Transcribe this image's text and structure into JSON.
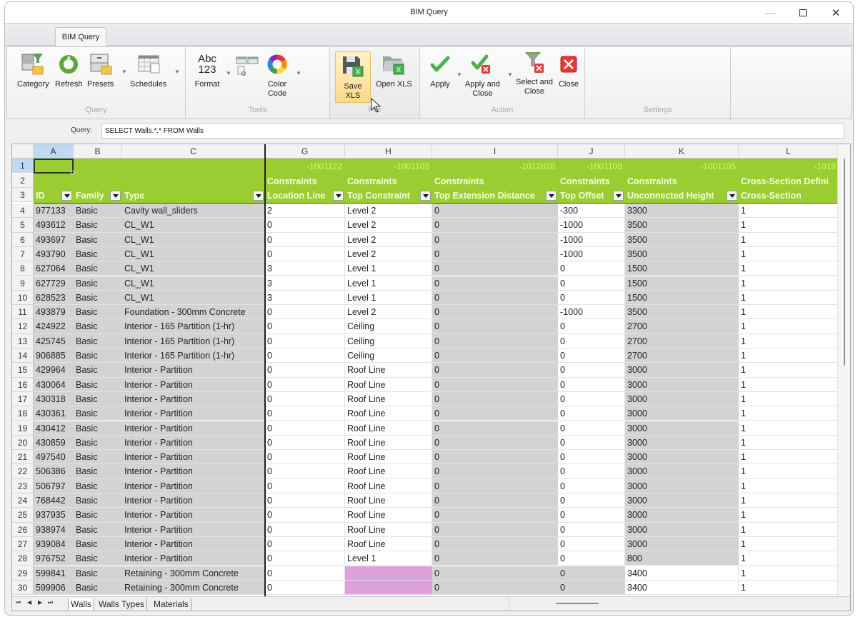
{
  "window": {
    "title": "BIM Query",
    "controls": {
      "minimize": "—",
      "maximize": "☐",
      "close": "✕"
    }
  },
  "ribbon": {
    "active_tab": "BIM Query",
    "groups": [
      {
        "label": "Query",
        "buttons": [
          {
            "label": "Category",
            "icon": "category-filter-icon"
          },
          {
            "label": "Refresh",
            "icon": "refresh-icon"
          },
          {
            "label": "Presets",
            "icon": "presets-icon",
            "dropdown": true
          },
          {
            "label": "Schedules",
            "icon": "schedules-icon",
            "dropdown": true
          }
        ]
      },
      {
        "label": "Tools",
        "buttons": [
          {
            "label": "Format",
            "icon": "format-abc123-icon",
            "dropdown": true,
            "icon_text": [
              "Abc",
              "123"
            ]
          },
          {
            "label": "",
            "icon": "column-tools-icon"
          },
          {
            "label": "Color Code",
            "label_lines": [
              "Color",
              "Code"
            ],
            "icon": "color-wheel-icon",
            "dropdown": true
          }
        ]
      },
      {
        "label": "File",
        "buttons": [
          {
            "label": "Save XLS",
            "icon": "save-xls-icon",
            "hovered": true
          },
          {
            "label": "Open XLS",
            "icon": "open-xls-icon"
          }
        ]
      },
      {
        "label": "Action",
        "buttons": [
          {
            "label": "Apply",
            "icon": "checkmark-icon",
            "dropdown": true
          },
          {
            "label": "Apply and Close",
            "label_lines": [
              "Apply and",
              "Close"
            ],
            "icon": "apply-close-icon",
            "dropdown": true
          },
          {
            "label": "Select and Close",
            "label_lines": [
              "Select and",
              "Close"
            ],
            "icon": "filter-close-icon"
          },
          {
            "label": "Close",
            "icon": "close-red-icon"
          }
        ]
      },
      {
        "label": "Settings",
        "buttons": []
      }
    ]
  },
  "query": {
    "label": "Query:",
    "value": "SELECT Walls.*.* FROM Walls"
  },
  "grid": {
    "selected_cell": "A1",
    "column_letters": [
      "A",
      "B",
      "C",
      "G",
      "H",
      "I",
      "J",
      "K",
      "L"
    ],
    "columns": [
      {
        "letter": "A",
        "param_id": "",
        "category": "",
        "name": "ID",
        "filter": true
      },
      {
        "letter": "B",
        "param_id": "",
        "category": "",
        "name": "Family",
        "filter": true
      },
      {
        "letter": "C",
        "param_id": "",
        "category": "",
        "name": "Type",
        "filter": true
      },
      {
        "letter": "G",
        "param_id": "-1001122",
        "category": "Constraints",
        "name": "Location Line",
        "filter": true
      },
      {
        "letter": "H",
        "param_id": "-1001103",
        "category": "Constraints",
        "name": "Top Constraint",
        "filter": true
      },
      {
        "letter": "I",
        "param_id": "-1012828",
        "category": "Constraints",
        "name": "Top Extension Distance",
        "filter": true
      },
      {
        "letter": "J",
        "param_id": "-1001109",
        "category": "Constraints",
        "name": "Top Offset",
        "filter": true
      },
      {
        "letter": "K",
        "param_id": "-1001105",
        "category": "Constraints",
        "name": "Unconnected Height",
        "filter": true
      },
      {
        "letter": "L",
        "param_id": "-1019",
        "category": "Cross-Section Defini",
        "name": "Cross-Section",
        "filter": false
      }
    ],
    "header_rows": [
      "1",
      "2",
      "3"
    ],
    "rows": [
      {
        "n": "4",
        "cells": [
          "977133",
          "Basic",
          "Cavity wall_sliders",
          "2",
          "Level 2",
          "0",
          "-300",
          "3300",
          "1"
        ]
      },
      {
        "n": "5",
        "cells": [
          "493612",
          "Basic",
          "CL_W1",
          "0",
          "Level 2",
          "0",
          "-1000",
          "3500",
          "1"
        ]
      },
      {
        "n": "6",
        "cells": [
          "493697",
          "Basic",
          "CL_W1",
          "0",
          "Level 2",
          "0",
          "-1000",
          "3500",
          "1"
        ]
      },
      {
        "n": "7",
        "cells": [
          "493790",
          "Basic",
          "CL_W1",
          "0",
          "Level 2",
          "0",
          "-1000",
          "3500",
          "1"
        ]
      },
      {
        "n": "8",
        "cells": [
          "627064",
          "Basic",
          "CL_W1",
          "3",
          "Level 1",
          "0",
          "0",
          "1500",
          "1"
        ]
      },
      {
        "n": "9",
        "cells": [
          "627729",
          "Basic",
          "CL_W1",
          "3",
          "Level 1",
          "0",
          "0",
          "1500",
          "1"
        ]
      },
      {
        "n": "10",
        "cells": [
          "628523",
          "Basic",
          "CL_W1",
          "3",
          "Level 1",
          "0",
          "0",
          "1500",
          "1"
        ]
      },
      {
        "n": "11",
        "cells": [
          "493879",
          "Basic",
          "Foundation - 300mm Concrete",
          "0",
          "Level 2",
          "0",
          "-1000",
          "3500",
          "1"
        ]
      },
      {
        "n": "12",
        "cells": [
          "424922",
          "Basic",
          "Interior - 165 Partition (1-hr)",
          "0",
          "Ceiling",
          "0",
          "0",
          "2700",
          "1"
        ]
      },
      {
        "n": "13",
        "cells": [
          "425745",
          "Basic",
          "Interior - 165 Partition (1-hr)",
          "0",
          "Ceiling",
          "0",
          "0",
          "2700",
          "1"
        ]
      },
      {
        "n": "14",
        "cells": [
          "906885",
          "Basic",
          "Interior - 165 Partition (1-hr)",
          "0",
          "Ceiling",
          "0",
          "0",
          "2700",
          "1"
        ]
      },
      {
        "n": "15",
        "cells": [
          "429964",
          "Basic",
          "Interior - Partition",
          "0",
          "Roof Line",
          "0",
          "0",
          "3000",
          "1"
        ]
      },
      {
        "n": "16",
        "cells": [
          "430064",
          "Basic",
          "Interior - Partition",
          "0",
          "Roof Line",
          "0",
          "0",
          "3000",
          "1"
        ]
      },
      {
        "n": "17",
        "cells": [
          "430318",
          "Basic",
          "Interior - Partition",
          "0",
          "Roof Line",
          "0",
          "0",
          "3000",
          "1"
        ]
      },
      {
        "n": "18",
        "cells": [
          "430361",
          "Basic",
          "Interior - Partition",
          "0",
          "Roof Line",
          "0",
          "0",
          "3000",
          "1"
        ]
      },
      {
        "n": "19",
        "cells": [
          "430412",
          "Basic",
          "Interior - Partition",
          "0",
          "Roof Line",
          "0",
          "0",
          "3000",
          "1"
        ]
      },
      {
        "n": "20",
        "cells": [
          "430859",
          "Basic",
          "Interior - Partition",
          "0",
          "Roof Line",
          "0",
          "0",
          "3000",
          "1"
        ]
      },
      {
        "n": "21",
        "cells": [
          "497540",
          "Basic",
          "Interior - Partition",
          "0",
          "Roof Line",
          "0",
          "0",
          "3000",
          "1"
        ]
      },
      {
        "n": "22",
        "cells": [
          "506386",
          "Basic",
          "Interior - Partition",
          "0",
          "Roof Line",
          "0",
          "0",
          "3000",
          "1"
        ]
      },
      {
        "n": "23",
        "cells": [
          "506797",
          "Basic",
          "Interior - Partition",
          "0",
          "Roof Line",
          "0",
          "0",
          "3000",
          "1"
        ]
      },
      {
        "n": "24",
        "cells": [
          "768442",
          "Basic",
          "Interior - Partition",
          "0",
          "Roof Line",
          "0",
          "0",
          "3000",
          "1"
        ]
      },
      {
        "n": "25",
        "cells": [
          "937935",
          "Basic",
          "Interior - Partition",
          "0",
          "Roof Line",
          "0",
          "0",
          "3000",
          "1"
        ]
      },
      {
        "n": "26",
        "cells": [
          "938974",
          "Basic",
          "Interior - Partition",
          "0",
          "Roof Line",
          "0",
          "0",
          "3000",
          "1"
        ]
      },
      {
        "n": "27",
        "cells": [
          "939084",
          "Basic",
          "Interior - Partition",
          "0",
          "Roof Line",
          "0",
          "0",
          "3000",
          "1"
        ]
      },
      {
        "n": "28",
        "cells": [
          "976752",
          "Basic",
          "Interior - Partition",
          "0",
          "Level 1",
          "0",
          "0",
          "800",
          "1"
        ]
      },
      {
        "n": "29",
        "cells": [
          "599841",
          "Basic",
          "Retaining - 300mm Concrete",
          "0",
          "",
          "0",
          "0",
          "3400",
          "1"
        ],
        "styles": [
          "gray",
          "gray",
          "gray",
          "white",
          "pink",
          "gray",
          "gray",
          "white",
          "white"
        ]
      },
      {
        "n": "30",
        "cells": [
          "599906",
          "Basic",
          "Retaining - 300mm Concrete",
          "0",
          "",
          "0",
          "0",
          "3400",
          "1"
        ],
        "styles": [
          "gray",
          "gray",
          "gray",
          "white",
          "pink",
          "gray",
          "gray",
          "white",
          "white"
        ]
      }
    ],
    "default_styles": [
      "gray",
      "gray",
      "gray",
      "white",
      "white",
      "gray",
      "white",
      "gray",
      "white"
    ]
  },
  "sheets": {
    "nav": [
      "⏮",
      "◀",
      "▶",
      "⏭"
    ],
    "tabs": [
      "Walls",
      "Walls Types",
      "Materials"
    ],
    "active": "Walls"
  },
  "colors": {
    "header_green": "#9acd32",
    "header_text": "#f4ffe0",
    "param_id_text": "#ccff66",
    "readonly_gray": "#d3d3d3",
    "missing_pink": "#dda0dd",
    "selection_blue": "#bfd9f0"
  }
}
